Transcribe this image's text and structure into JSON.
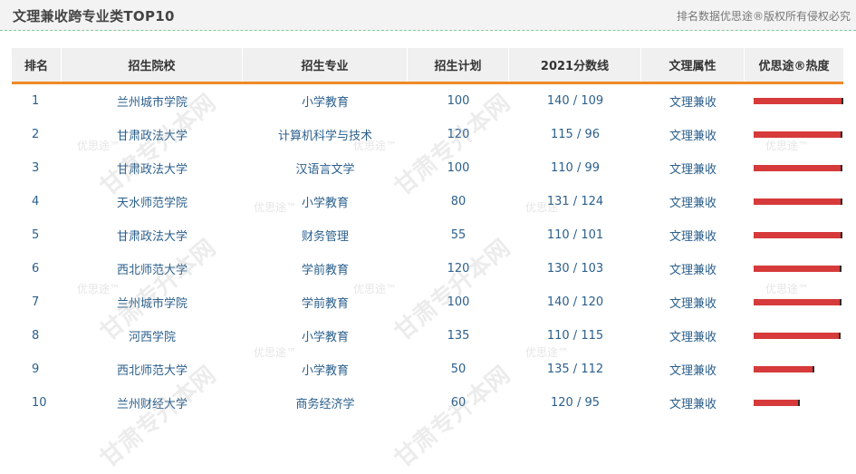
{
  "header": {
    "title": "文理兼收跨专业类TOP10",
    "copyright": "排名数据优思途®版权所有侵权必究"
  },
  "table": {
    "columns": [
      "排名",
      "招生院校",
      "招生专业",
      "招生计划",
      "2021分数线",
      "文理属性",
      "优思途®热度"
    ],
    "rows": [
      {
        "rank": "1",
        "school": "兰州城市学院",
        "major": "小学教育",
        "plan": "100",
        "score": "140 / 109",
        "attr": "文理兼收",
        "heat": 1.0
      },
      {
        "rank": "2",
        "school": "甘肃政法大学",
        "major": "计算机科学与技术",
        "plan": "120",
        "score": "115 / 96",
        "attr": "文理兼收",
        "heat": 0.99
      },
      {
        "rank": "3",
        "school": "甘肃政法大学",
        "major": "汉语言文学",
        "plan": "100",
        "score": "110 / 99",
        "attr": "文理兼收",
        "heat": 0.99
      },
      {
        "rank": "4",
        "school": "天水师范学院",
        "major": "小学教育",
        "plan": "80",
        "score": "131 / 124",
        "attr": "文理兼收",
        "heat": 0.99
      },
      {
        "rank": "5",
        "school": "甘肃政法大学",
        "major": "财务管理",
        "plan": "55",
        "score": "110 / 101",
        "attr": "文理兼收",
        "heat": 0.99
      },
      {
        "rank": "6",
        "school": "西北师范大学",
        "major": "学前教育",
        "plan": "120",
        "score": "130 / 103",
        "attr": "文理兼收",
        "heat": 0.98
      },
      {
        "rank": "7",
        "school": "兰州城市学院",
        "major": "学前教育",
        "plan": "100",
        "score": "140 / 120",
        "attr": "文理兼收",
        "heat": 0.98
      },
      {
        "rank": "8",
        "school": "河西学院",
        "major": "小学教育",
        "plan": "135",
        "score": "110 / 115",
        "attr": "文理兼收",
        "heat": 0.97
      },
      {
        "rank": "9",
        "school": "西北师范大学",
        "major": "小学教育",
        "plan": "50",
        "score": "135 / 112",
        "attr": "文理兼收",
        "heat": 0.68
      },
      {
        "rank": "10",
        "school": "兰州财经大学",
        "major": "商务经济学",
        "plan": "60",
        "score": "120 / 95",
        "attr": "文理兼收",
        "heat": 0.52
      }
    ]
  },
  "watermark": {
    "brand": "甘肃专升本网",
    "mark": "优思途™"
  },
  "colors": {
    "accent_line": "#f08a24",
    "bar": "#d63a3a",
    "text": "#2b5f8c"
  }
}
